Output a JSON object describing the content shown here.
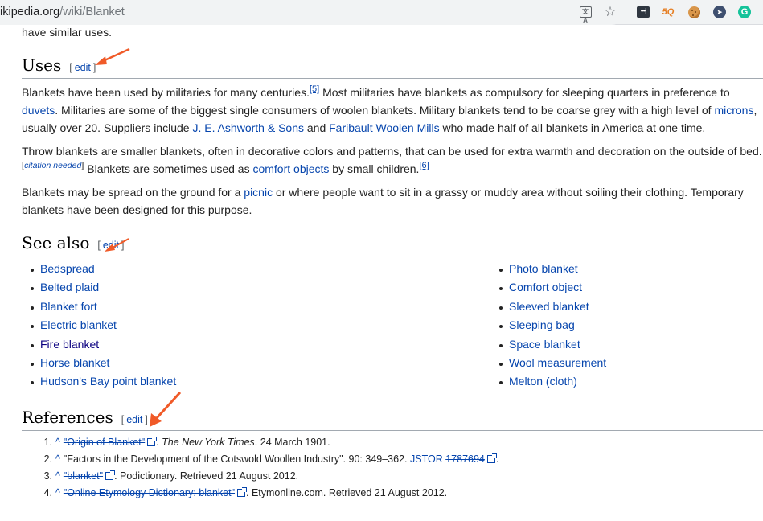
{
  "browser": {
    "url_host": "ikipedia.org",
    "url_path": "/wiki/Blanket",
    "icons": [
      "translate-icon",
      "bookmark-star-icon",
      "extension-dots-icon",
      "extension-5q-icon",
      "extension-cookie-icon",
      "extension-cursor-icon",
      "grammarly-icon"
    ],
    "ext1_text": "•••|",
    "ext2_text": "5Q",
    "ext4_text": "➤",
    "ext5_text": "G",
    "translate_text": "文A",
    "star_text": "☆"
  },
  "page": {
    "previous_fragment": "have similar uses.",
    "edit_label": "edit",
    "bracket_open": "[",
    "bracket_close": "]",
    "uses": {
      "heading": "Uses",
      "p1": {
        "t1": "Blankets have been used by militaries for many centuries.",
        "ref1": "[5]",
        "t2": " Most militaries have blankets as compulsory for sleeping quarters in preference to ",
        "link1": "duvets",
        "t3": ". Militaries are some of the biggest single consumers of woolen blankets. Military blankets tend to be coarse grey with a high level of ",
        "link2": "microns",
        "t4": ", usually over 20. Suppliers include ",
        "link3": "J. E. Ashworth & Sons",
        "t5": " and ",
        "link4": "Faribault Woolen Mills",
        "t6": " who made half of all blankets in America at one time."
      },
      "p2": {
        "t1": "Throw blankets are smaller blankets, often in decorative colors and patterns, that can be used for extra warmth and decoration on the outside of bed.",
        "cn_open": "[",
        "cn": "citation needed",
        "cn_close": "]",
        "t2": " Blankets are sometimes used as ",
        "link1": "comfort objects",
        "t3": " by small children.",
        "ref": "[6]"
      },
      "p3": {
        "t1": "Blankets may be spread on the ground for a ",
        "link1": "picnic",
        "t2": " or where people want to sit in a grassy or muddy area without soiling their clothing. Temporary blankets have been designed for this purpose."
      }
    },
    "see_also": {
      "heading": "See also",
      "col1": [
        "Bedspread",
        "Belted plaid",
        "Blanket fort",
        "Electric blanket",
        "Fire blanket",
        "Horse blanket",
        "Hudson's Bay point blanket"
      ],
      "col2": [
        "Photo blanket",
        "Comfort object",
        "Sleeved blanket",
        "Sleeping bag",
        "Space blanket",
        "Wool measurement",
        "Melton (cloth)"
      ]
    },
    "references": {
      "heading": "References",
      "caret": "^",
      "items": [
        {
          "num": "1.",
          "link": "\"Origin of Blanket\"",
          "rest_italic": "The New York Times",
          "rest": ". 24 March 1901.",
          "pre": ". "
        },
        {
          "num": "2.",
          "text": "\"Factors in the Development of the Cotswold Woollen Industry\". 90: 349–362. ",
          "jstor": "JSTOR",
          "jstor_id": "1787694",
          "end": "."
        },
        {
          "num": "3.",
          "link": "\"blanket\"",
          "rest": ". Podictionary. Retrieved 21 August 2012."
        },
        {
          "num": "4.",
          "link": "\"Online Etymology Dictionary: blanket\"",
          "rest": ". Etymonline.com. Retrieved 21 August 2012."
        }
      ]
    }
  },
  "annotations": {
    "arrow_color": "#f05a28"
  }
}
